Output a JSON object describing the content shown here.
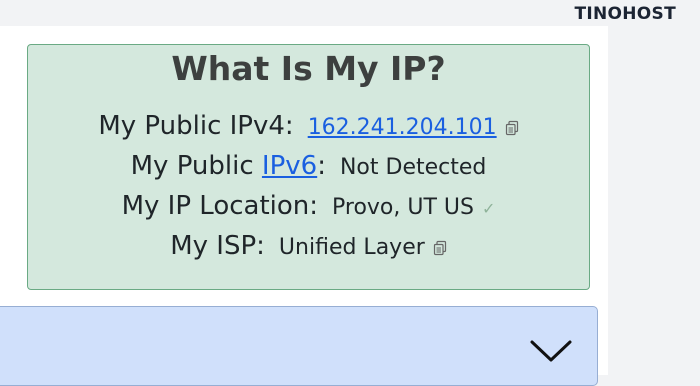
{
  "brand": {
    "prefix": "TINO",
    "suffix": "HOST"
  },
  "ip_card": {
    "title": "What Is My IP?",
    "ipv4": {
      "label": "My Public IPv4:",
      "value": "162.241.204.101",
      "icon": "copy-icon"
    },
    "ipv6": {
      "label_prefix": "My Public",
      "label_link": "IPv6",
      "label_suffix": ":",
      "value": "Not Detected"
    },
    "location": {
      "label": "My IP Location:",
      "value": "Provo, UT US",
      "icon": "check-icon"
    },
    "isp": {
      "label": "My ISP:",
      "value": "Unified Layer",
      "icon": "copy-icon"
    }
  },
  "accordion": {
    "icon": "chevron-down-icon"
  },
  "colors": {
    "card_bg": "#d4e8dd",
    "card_border": "#6aaa84",
    "link": "#1a5fe0",
    "accordion_bg": "#d0e0fb",
    "title_text": "#3d403f"
  }
}
